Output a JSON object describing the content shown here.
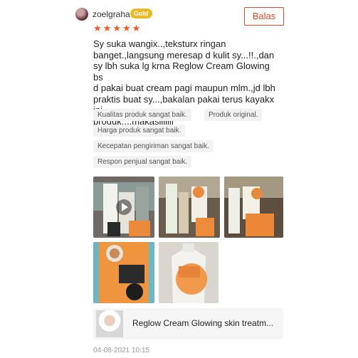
{
  "review": {
    "username": "zoelgraha",
    "badge": "Gold",
    "reply_button": "Balas",
    "rating": 5,
    "text": "Sy suka wangix..,teksturx ringan\nbanget.,langsung meresap d kulit sy...!!.,dan\nsy lbh suka lg krna Reglow Cream Glowing bs\nd pakai buat cream pagi maupun mlm.,jd lbh\npraktis buat sy...,bakalan pakai terus kayakx ini\nproduk...,makasiiiiiii",
    "tags": [
      "Kualitas produk sangat baik.",
      "Produk original.",
      "Harga produk sangat baik.",
      "Kecepatan pengiriman sangat baik.",
      "Respon penjual sangat baik."
    ],
    "product_title": "Reglow Cream Glowing skin treatm...",
    "date": "04-08-2021 10:15"
  },
  "colors": {
    "accent": "#e04a2f",
    "star": "#f05a28",
    "gold_badge": "#e9b928",
    "tag_bg": "#f2f2f2"
  },
  "icons": {
    "star": "star-icon",
    "play": "play-icon"
  }
}
